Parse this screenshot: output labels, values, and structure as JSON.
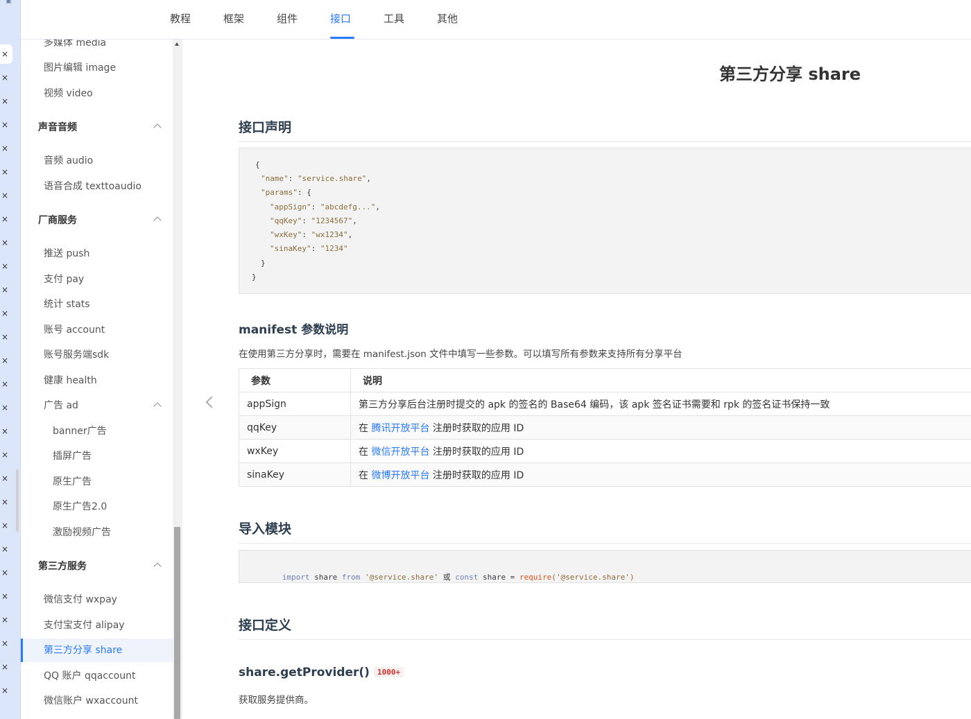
{
  "nav": {
    "items": [
      {
        "label": "教程"
      },
      {
        "label": "框架"
      },
      {
        "label": "组件"
      },
      {
        "label": "接口"
      },
      {
        "label": "工具"
      },
      {
        "label": "其他"
      }
    ],
    "active_index": 3
  },
  "sidebar": {
    "items": [
      {
        "label": "多媒体 media"
      },
      {
        "label": "图片编辑 image"
      },
      {
        "label": "视频 video"
      },
      {
        "label": "声音音频"
      },
      {
        "label": "音频 audio"
      },
      {
        "label": "语音合成 texttoaudio"
      },
      {
        "label": "厂商服务"
      },
      {
        "label": "推送 push"
      },
      {
        "label": "支付 pay"
      },
      {
        "label": "统计 stats"
      },
      {
        "label": "账号 account"
      },
      {
        "label": "账号服务端sdk"
      },
      {
        "label": "健康 health"
      },
      {
        "label": "广告 ad"
      },
      {
        "label": "banner广告"
      },
      {
        "label": "插屏广告"
      },
      {
        "label": "原生广告"
      },
      {
        "label": "原生广告2.0"
      },
      {
        "label": "激励视频广告"
      },
      {
        "label": "第三方服务"
      },
      {
        "label": "微信支付 wxpay"
      },
      {
        "label": "支付宝支付 alipay"
      },
      {
        "label": "第三方分享 share"
      },
      {
        "label": "QQ 账户 qqaccount"
      },
      {
        "label": "微信账户 wxaccount"
      }
    ]
  },
  "page": {
    "title": "第三方分享 share",
    "section_declaration": "接口声明",
    "declaration_code": {
      "l1": "{",
      "name_key": "\"name\"",
      "name_val": "\"service.share\"",
      "params_key": "\"params\"",
      "appsign_key": "\"appSign\"",
      "appsign_val": "\"abcdefg...\"",
      "qqkey_key": "\"qqKey\"",
      "qqkey_val": "\"1234567\"",
      "wxkey_key": "\"wxKey\"",
      "wxkey_val": "\"wx1234\"",
      "sinakey_key": "\"sinaKey\"",
      "sinakey_val": "\"1234\"",
      "l_close_inner": "}",
      "l_close": "}"
    },
    "manifest_title": "manifest 参数说明",
    "manifest_desc": "在使用第三方分享时，需要在 manifest.json 文件中填写一些参数。可以填写所有参数来支持所有分享平台",
    "table": {
      "headers": [
        "参数",
        "说明"
      ],
      "rows": [
        {
          "param": "appSign",
          "pre": "第三方分享后台注册时提交的 apk 的签名的 Base64 编码，该 apk 签名证书需要和 rpk 的签名证书保持一致",
          "link": "",
          "post": ""
        },
        {
          "param": "qqKey",
          "pre": "在 ",
          "link": "腾讯开放平台",
          "post": " 注册时获取的应用 ID"
        },
        {
          "param": "wxKey",
          "pre": "在 ",
          "link": "微信开放平台",
          "post": " 注册时获取的应用 ID"
        },
        {
          "param": "sinaKey",
          "pre": "在 ",
          "link": "微博开放平台",
          "post": " 注册时获取的应用 ID"
        }
      ]
    },
    "section_import": "导入模块",
    "import_code": {
      "kw_import": "import",
      "name1": " share ",
      "kw_from": "from",
      "str1": " '@service.share' ",
      "or": "或",
      "kw_const": " const",
      "name2": " share = ",
      "req": "require",
      "str2": "('@service.share')"
    },
    "section_definition": "接口定义",
    "method_name": "share.getProvider()",
    "method_badge": "1000+",
    "method_desc": "获取服务提供商。"
  }
}
